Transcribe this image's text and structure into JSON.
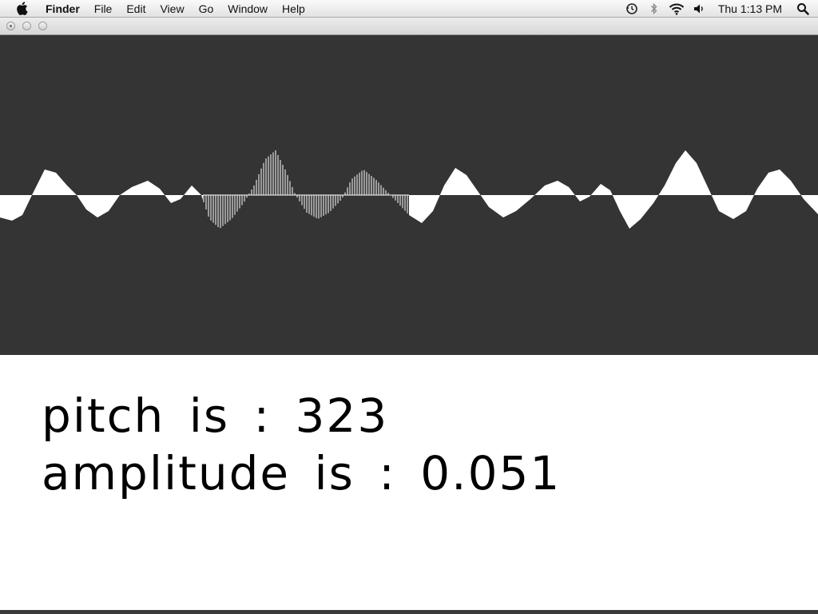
{
  "menubar": {
    "app_name": "Finder",
    "menus": [
      "File",
      "Edit",
      "View",
      "Go",
      "Window",
      "Help"
    ],
    "clock": "Thu 1:13 PM",
    "status_icons": [
      "time-machine-icon",
      "bluetooth-icon",
      "wifi-icon",
      "volume-icon",
      "spotlight-icon"
    ]
  },
  "window": {
    "buttons": [
      "close",
      "minimize",
      "zoom"
    ]
  },
  "visualizer": {
    "background_color": "#343434",
    "wave_color": "#ffffff"
  },
  "readout": {
    "pitch_label": "pitch is :",
    "pitch_value": "323",
    "amplitude_label": "amplitude is :",
    "amplitude_value": "0.051"
  }
}
